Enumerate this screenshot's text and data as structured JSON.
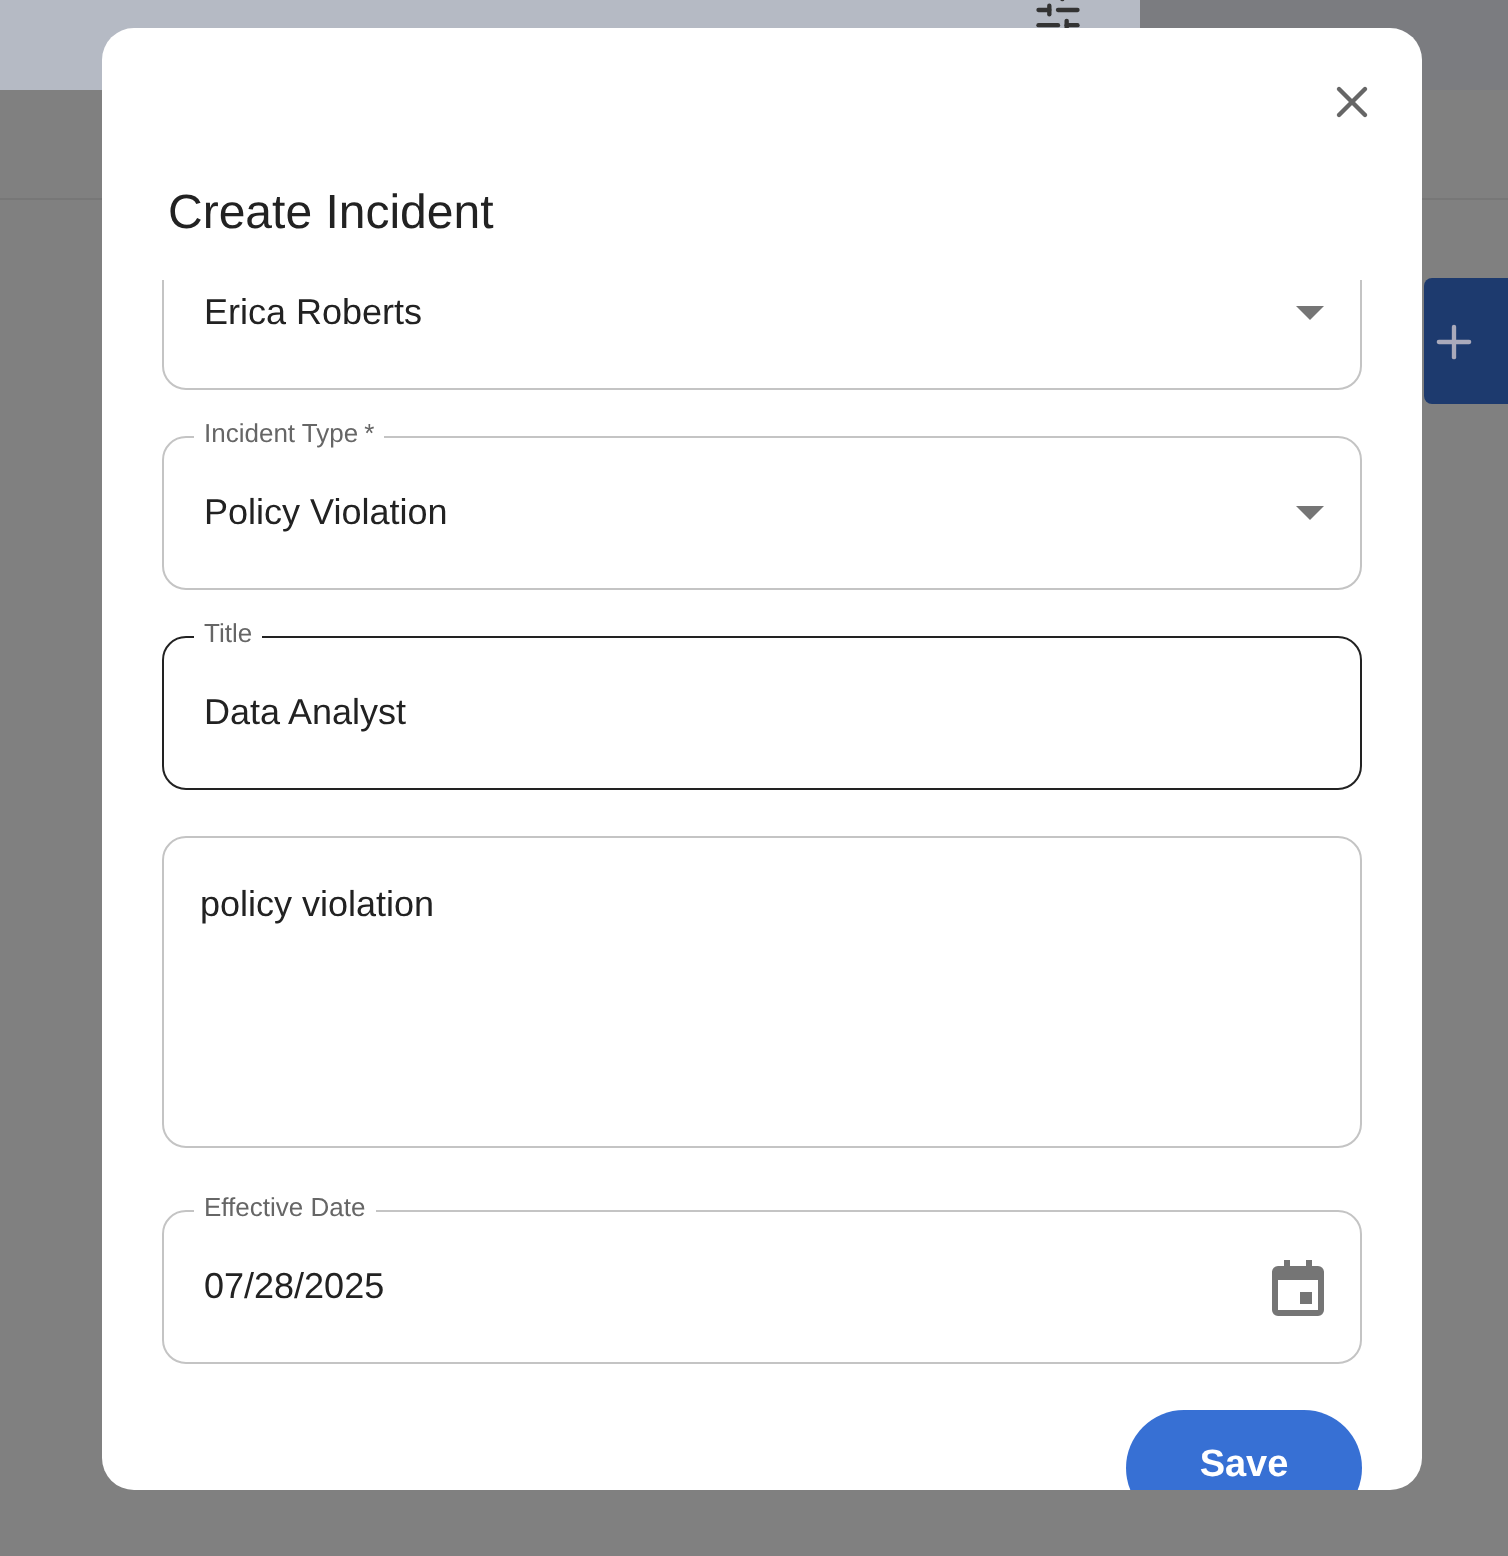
{
  "dialog": {
    "title": "Create Incident"
  },
  "fields": [
    {
      "kind": "select",
      "value": "Erica Roberts",
      "active": false
    },
    {
      "kind": "select",
      "label": "Incident Type",
      "required_mark": "*",
      "value": "Policy Violation",
      "active": false
    },
    {
      "kind": "text",
      "label": "Title",
      "value": "Data Analyst",
      "active": true
    },
    {
      "kind": "textarea",
      "value": "policy violation",
      "active": false
    },
    {
      "kind": "date",
      "label": "Effective Date",
      "value": "07/28/2025",
      "active": false
    }
  ],
  "buttons": [
    {
      "label": "Save"
    }
  ]
}
